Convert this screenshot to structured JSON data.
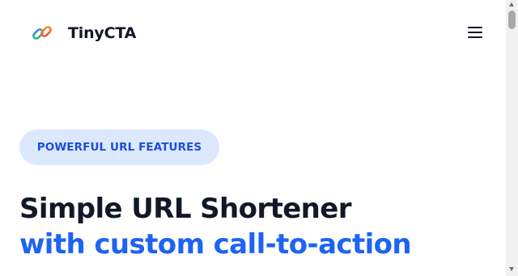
{
  "header": {
    "brand_name": "TinyCTA",
    "logo_icon": "chain-link-icon",
    "menu_icon": "hamburger-menu-icon"
  },
  "hero": {
    "badge_text": "POWERFUL URL FEATURES",
    "title_line_1": "Simple URL Shortener",
    "title_line_2": "with custom call-to-action"
  },
  "colors": {
    "accent": "#1e63f2",
    "badge_background": "#dbe8fd",
    "badge_text": "#1d4ed8",
    "heading_text": "#111827",
    "logo_gradient": [
      "#22c55e",
      "#3b82f6",
      "#ef4444",
      "#f59e0b"
    ]
  }
}
